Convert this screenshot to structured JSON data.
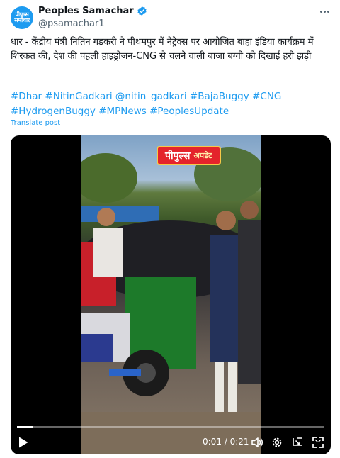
{
  "account": {
    "display_name": "Peoples Samachar",
    "handle": "@psamachar1",
    "avatar_text_1": "पीपुल्स",
    "avatar_text_2": "समाचार",
    "verified_icon": "verified-badge-icon",
    "more_icon": "more-options-icon"
  },
  "post": {
    "text": "धार - केंद्रीय मंत्री नितिन गडकरी ने पीथमपुर में नैट्रेक्स पर आयोजित बाहा इंडिया कार्यक्रम में शिरकत की, देश की पहली हाइड्रोजन-CNG से चलने वाली बाजा बग्गी को दिखाई हरी झड़ी",
    "hashtags_line1": "#Dhar #NitinGadkari @nitin_gadkari #BajaBuggy #CNG",
    "hashtags_line2": "#HydrogenBuggy #MPNews #PeoplesUpdate",
    "translate_label": "Translate post"
  },
  "video": {
    "brand_text": "पीपुल्स",
    "brand_subtext": "अपडेट",
    "progress": 0.05,
    "time_label": "0:01 / 0:21",
    "icons": [
      "play-icon",
      "volume-icon",
      "settings-icon",
      "picture-in-picture-icon",
      "fullscreen-icon"
    ]
  },
  "colors": {
    "accent": "#1d9bf0",
    "text": "#0f1419",
    "secondary": "#536471",
    "brand_red": "#e4232b"
  }
}
